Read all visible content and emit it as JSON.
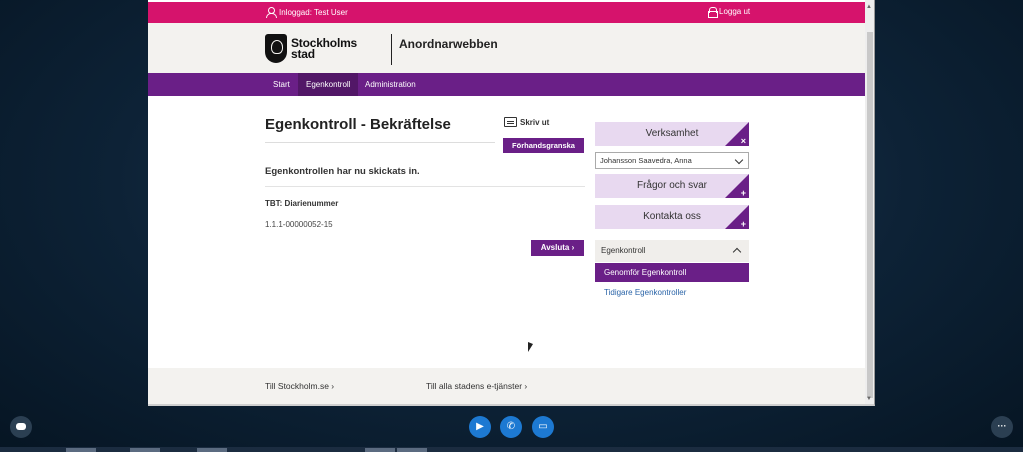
{
  "topbar": {
    "user_label": "Inloggad: Test User",
    "logout_label": "Logga ut"
  },
  "header": {
    "logo_line1": "Stockholms",
    "logo_line2": "stad",
    "app_title": "Anordnarwebben"
  },
  "nav": {
    "items": [
      {
        "label": "Start"
      },
      {
        "label": "Egenkontroll"
      },
      {
        "label": "Administration"
      }
    ]
  },
  "main": {
    "title": "Egenkontroll - Bekräftelse",
    "print_label": "Skriv ut",
    "preview_label": "Förhandsgranska",
    "submitted_message": "Egenkontrollen har nu skickats in.",
    "tbt_label": "TBT: Diarienummer",
    "tbt_value": "1.1.1-00000052-15",
    "close_label": "Avsluta ›"
  },
  "sidebar": {
    "verksamhet_label": "Verksamhet",
    "verksamhet_symbol": "×",
    "selected_person": "Johansson Saavedra, Anna",
    "fragor_label": "Frågor och svar",
    "kontakt_label": "Kontakta oss",
    "plus_symbol": "+",
    "accordion_title": "Egenkontroll",
    "accordion_active": "Genomför Egenkontroll",
    "accordion_link": "Tidigare Egenkontroller"
  },
  "footer": {
    "link1": "Till Stockholm.se ›",
    "link2": "Till alla stadens e-tjänster ›"
  },
  "overlay": {
    "more_label": "···"
  },
  "colors": {
    "pink": "#d6136c",
    "purple": "#6a1f87",
    "light_purple": "#e8d9f0",
    "call_blue": "#1d79d2"
  }
}
